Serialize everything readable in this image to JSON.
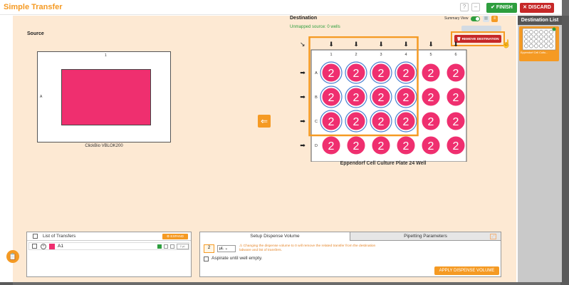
{
  "app": {
    "title": "Simple Transfer",
    "finish_label": "✔ FINISH",
    "discard_label": "✕ DISCARD"
  },
  "source": {
    "section_label": "Source",
    "col_label": "1",
    "row_label": "A",
    "plate_name": "ClickBio VBLOK200"
  },
  "destination": {
    "section_label": "Destination",
    "unmapped_text": "Unmapped source: 0 wells",
    "summary_view_label": "Summary View",
    "remove_label": "REMOVE DESTINATION",
    "plate_name": "Eppendorf Cell Culture Plate 24 Well",
    "columns": [
      "1",
      "2",
      "3",
      "4",
      "5",
      "6"
    ],
    "rows": [
      "A",
      "B",
      "C",
      "D"
    ],
    "well_value": "2",
    "selected_cols": 4,
    "selected_rows": 3
  },
  "dest_list": {
    "header": "Destination List",
    "card_name": "Eppendorf Cell Cultu..."
  },
  "transfers": {
    "title": "List of Transfers",
    "expand_label": "⚙ EXPAND",
    "items": [
      {
        "label": "A1",
        "volume": "2 µL"
      }
    ]
  },
  "setup": {
    "tab_dispense": "Setup Dispense Volume",
    "tab_pipetting": "Pipetting Parameters",
    "volume_value": "2",
    "unit": "µL",
    "warning": "Changing the dispense volume to 0 will remove the related transfer from the destination labware and list of transfers.",
    "aspirate_label": "Aspirate until well empty.",
    "apply_label": "APPLY DISPENSE VOLUME"
  },
  "colors": {
    "accent": "#f59a23",
    "well": "#ef2f6f",
    "finish": "#2e9e3e",
    "discard": "#c62828",
    "workspace": "#fde9d3"
  }
}
